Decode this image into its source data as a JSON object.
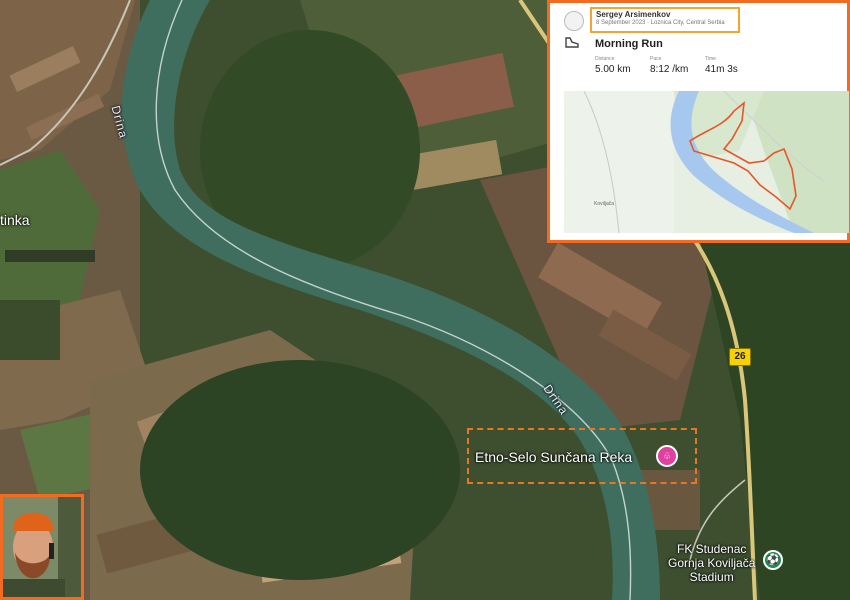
{
  "map": {
    "river_label_1": "Drina",
    "river_label_2": "Drina",
    "town_label": "tinka",
    "poi_label": "Etno-Selo Sunčana Reka",
    "poi_pin_text": "♧",
    "road_number": "26",
    "stadium_label_line1": "FK Studenac",
    "stadium_label_line2": "Gornja Koviljača",
    "stadium_label_line3": "Stadium",
    "colors": {
      "river": "#3f6e5f",
      "highlight": "#e87722",
      "poi_pin": "#e040a0",
      "stadium_pin": "#15904a"
    }
  },
  "activity_card": {
    "athlete_name": "Sergey Arsimenkov",
    "date_location": "8 September 2023 · Loznica City, Central Serbia",
    "title": "Morning Run",
    "stats": [
      {
        "label": "Distance",
        "value": "5.00 km"
      },
      {
        "label": "Pace",
        "value": "8:12 /km"
      },
      {
        "label": "Time",
        "value": "41m 3s"
      }
    ],
    "map_place_label": "Koviljača",
    "route_color": "#e8552a"
  },
  "photo": {
    "icon": "person-photo",
    "border_color": "#f26b21"
  }
}
